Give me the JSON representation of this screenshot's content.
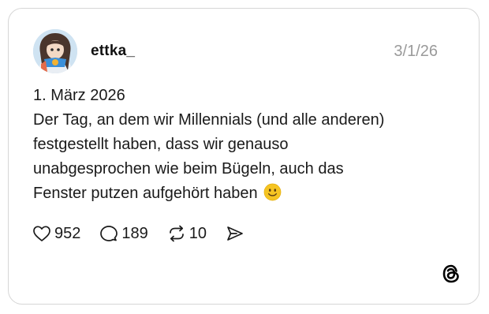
{
  "post": {
    "username": "ettka_",
    "date": "3/1/26",
    "text_lines": [
      "1. März 2026",
      "Der Tag, an dem wir Millennials (und alle anderen)",
      "festgestellt haben, dass wir genauso",
      "unabgesprochen wie beim Bügeln, auch das",
      "Fenster putzen aufgehört haben"
    ],
    "emoji": "slightly-smiling-face-emoji"
  },
  "actions": {
    "likes": "952",
    "replies": "189",
    "reposts": "10",
    "like_icon": "heart-icon",
    "reply_icon": "speech-bubble-icon",
    "repost_icon": "repost-arrows-icon",
    "share_icon": "send-icon"
  },
  "branding": {
    "logo": "threads-logo-icon"
  },
  "colors": {
    "card_border": "#d6d6d6",
    "date": "#9a9a9a",
    "text": "#1a1a1a",
    "emoji": "#f5c423"
  }
}
